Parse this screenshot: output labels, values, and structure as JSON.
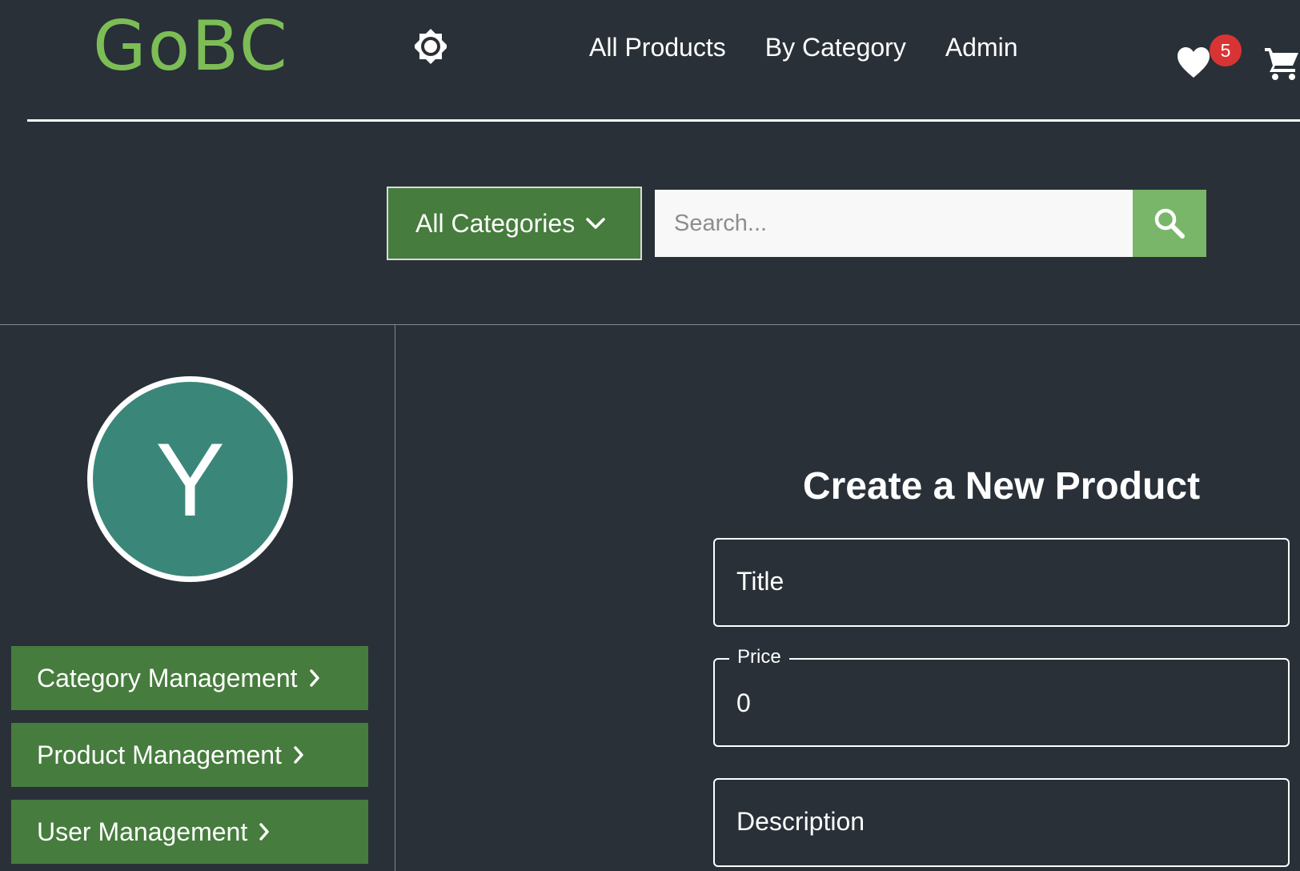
{
  "header": {
    "logo_text": "GoBC",
    "nav": {
      "all_products": "All Products",
      "by_category": "By Category",
      "admin": "Admin"
    },
    "wishlist_count": "5",
    "icons": {
      "theme": "sun-icon",
      "wishlist": "heart-icon",
      "cart": "cart-icon"
    }
  },
  "search": {
    "category_label": "All Categories",
    "placeholder": "Search..."
  },
  "sidebar": {
    "avatar_initial": "Y",
    "items": [
      {
        "label": "Category Management"
      },
      {
        "label": "Product Management"
      },
      {
        "label": "User Management"
      }
    ]
  },
  "form": {
    "title": "Create a New Product",
    "title_field": {
      "placeholder": "Title"
    },
    "price_field": {
      "label": "Price",
      "value": "0"
    },
    "description_field": {
      "placeholder": "Description"
    }
  },
  "colors": {
    "background": "#293038",
    "brand_green": "#7cbe55",
    "button_green": "#467c3d",
    "search_button_green": "#79b66a",
    "avatar_teal": "#3a877a",
    "badge_red": "#d93434"
  }
}
